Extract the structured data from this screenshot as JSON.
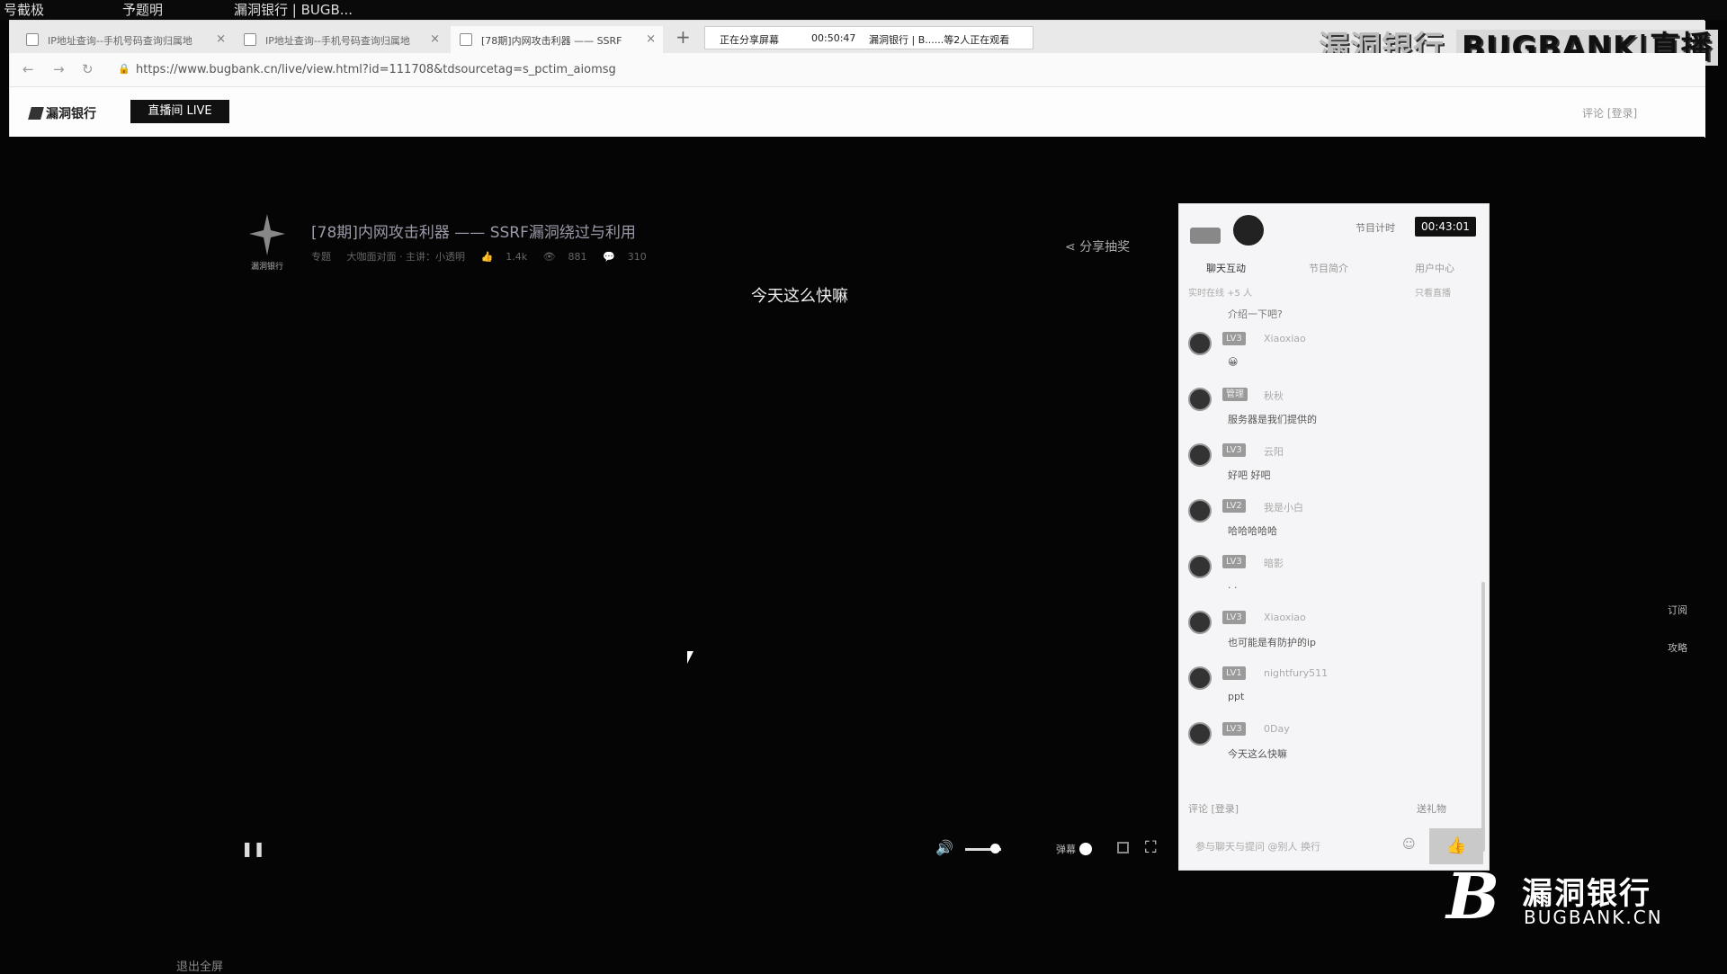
{
  "sysbar": {
    "item1": "号截极",
    "item2": "予题明",
    "item3": "漏洞银行 | BUGB..."
  },
  "tabs": [
    {
      "label": "IP地址查询--手机号码查询归属地"
    },
    {
      "label": "IP地址查询--手机号码查询归属地"
    },
    {
      "label": "[78期]内网攻击利器 —— SSRF"
    }
  ],
  "newtab": "+",
  "share": {
    "status": "正在分享屏幕",
    "time": "00:50:47",
    "viewers": "漏洞银行 | B......等2人正在观看"
  },
  "watermark_top": {
    "text": "漏洞银行",
    "bold": "BUGBANK|直播"
  },
  "address": {
    "url": "https://www.bugbank.cn/live/view.html?id=111708&tdsourcetag=s_pctim_aiomsg"
  },
  "site": {
    "logo": "漏洞银行",
    "live_button": "直播间 LIVE",
    "right": "评论  [登录]"
  },
  "video": {
    "host_label": "漏洞银行",
    "title": "[78期]内网攻击利器 —— SSRF漏洞绕过与利用",
    "meta": {
      "tag": "专题",
      "speaker": "大咖面对面 · 主讲：小透明",
      "likes": "1.4k",
      "views": "881",
      "comments": "310"
    },
    "share_label": "分享抽奖",
    "subtitle": "今天这么快嘛"
  },
  "controls": {
    "danmu_label": "弹幕"
  },
  "chat": {
    "timer_label": "节目计时",
    "timer": "00:43:01",
    "tabs": [
      "聊天互动",
      "节目简介",
      "用户中心"
    ],
    "note": "实时在线 +5 人",
    "filter": "只看直播",
    "first_line": "介绍一下吧?",
    "messages": [
      {
        "level": "LV3",
        "nick": "Xiaoxiao",
        "text": "😀"
      },
      {
        "level": "管理",
        "nick": "秋秋",
        "text": "服务器是我们提供的"
      },
      {
        "level": "LV3",
        "nick": "云阳",
        "text": "好吧 好吧"
      },
      {
        "level": "LV2",
        "nick": "我是小白",
        "text": "哈哈哈哈哈"
      },
      {
        "level": "LV3",
        "nick": "暗影",
        "text": ". ."
      },
      {
        "level": "LV3",
        "nick": "Xiaoxiao",
        "text": "也可能是有防护的ip"
      },
      {
        "level": "LV1",
        "nick": "nightfury511",
        "text": "ppt"
      },
      {
        "level": "LV3",
        "nick": "0Day",
        "text": "今天这么快嘛"
      }
    ],
    "login": "评论 [登录]",
    "gift": "送礼物",
    "input_placeholder": "参与聊天与提问  @别人 换行",
    "like_icon": "👍"
  },
  "side": {
    "subscribe": "订阅",
    "guide": "攻略"
  },
  "brand": {
    "letter": "B",
    "cn": "漏洞银行",
    "en": "BUGBANK.CN"
  },
  "bottom": {
    "item1": "退出全屏"
  }
}
